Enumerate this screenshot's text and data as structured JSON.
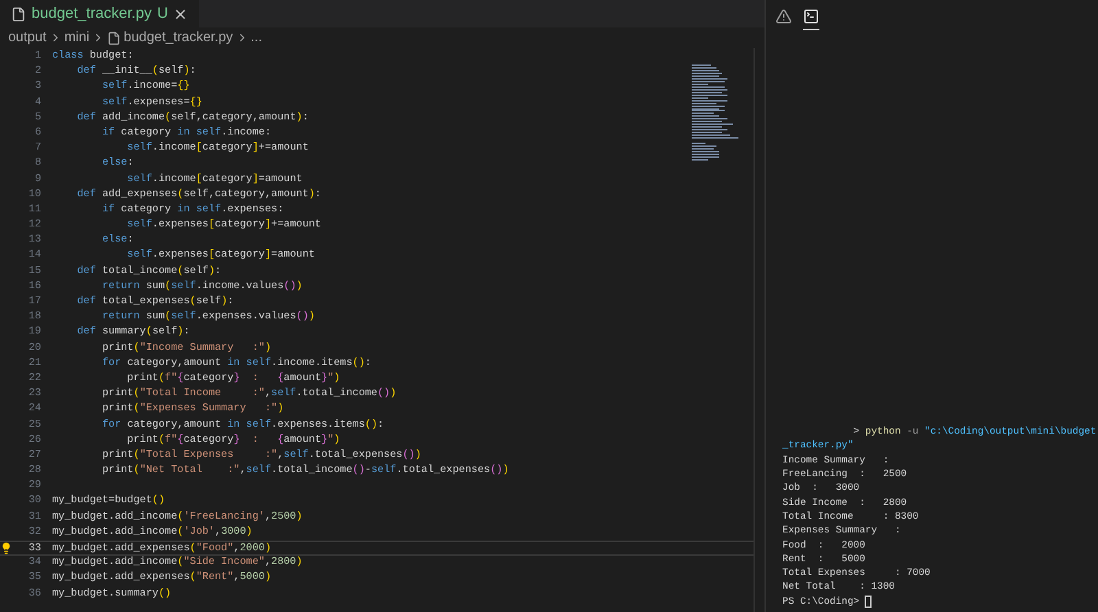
{
  "editor_tab": {
    "filename": "budget_tracker.py",
    "status": "U",
    "selected": true
  },
  "breadcrumbs": {
    "folders": [
      "output",
      "mini"
    ],
    "file": "budget_tracker.py",
    "more": "..."
  },
  "code_lines": [
    {
      "number": "1",
      "current": false,
      "tokens": [
        {
          "kind": "kw",
          "text": "class"
        },
        {
          "kind": "pl",
          "text": " budget:"
        }
      ]
    },
    {
      "number": "2",
      "current": false,
      "tokens": [
        {
          "kind": "kw",
          "text": "    def"
        },
        {
          "kind": "pl",
          "text": " __init__"
        },
        {
          "kind": "b1",
          "text": "("
        },
        {
          "kind": "pl",
          "text": "self"
        },
        {
          "kind": "b1",
          "text": ")"
        },
        {
          "kind": "pl",
          "text": ":"
        }
      ]
    },
    {
      "number": "3",
      "current": false,
      "tokens": [
        {
          "kind": "sf",
          "text": "        self"
        },
        {
          "kind": "pl",
          "text": ".income="
        },
        {
          "kind": "b1",
          "text": "{}"
        }
      ]
    },
    {
      "number": "4",
      "current": false,
      "tokens": [
        {
          "kind": "sf",
          "text": "        self"
        },
        {
          "kind": "pl",
          "text": ".expenses="
        },
        {
          "kind": "b1",
          "text": "{}"
        }
      ]
    },
    {
      "number": "5",
      "current": false,
      "tokens": [
        {
          "kind": "kw",
          "text": "    def"
        },
        {
          "kind": "pl",
          "text": " add_income"
        },
        {
          "kind": "b1",
          "text": "("
        },
        {
          "kind": "pl",
          "text": "self,category,amount"
        },
        {
          "kind": "b1",
          "text": ")"
        },
        {
          "kind": "pl",
          "text": ":"
        }
      ]
    },
    {
      "number": "6",
      "current": false,
      "tokens": [
        {
          "kind": "kw",
          "text": "        if"
        },
        {
          "kind": "pl",
          "text": " category "
        },
        {
          "kind": "kw",
          "text": "in"
        },
        {
          "kind": "sf",
          "text": " self"
        },
        {
          "kind": "pl",
          "text": ".income:"
        }
      ]
    },
    {
      "number": "7",
      "current": false,
      "tokens": [
        {
          "kind": "sf",
          "text": "            self"
        },
        {
          "kind": "pl",
          "text": ".income"
        },
        {
          "kind": "b1",
          "text": "["
        },
        {
          "kind": "pl",
          "text": "category"
        },
        {
          "kind": "b1",
          "text": "]"
        },
        {
          "kind": "pl",
          "text": "+=amount"
        }
      ]
    },
    {
      "number": "8",
      "current": false,
      "tokens": [
        {
          "kind": "kw",
          "text": "        else"
        },
        {
          "kind": "pl",
          "text": ":"
        }
      ]
    },
    {
      "number": "9",
      "current": false,
      "tokens": [
        {
          "kind": "sf",
          "text": "            self"
        },
        {
          "kind": "pl",
          "text": ".income"
        },
        {
          "kind": "b1",
          "text": "["
        },
        {
          "kind": "pl",
          "text": "category"
        },
        {
          "kind": "b1",
          "text": "]"
        },
        {
          "kind": "pl",
          "text": "=amount"
        }
      ]
    },
    {
      "number": "10",
      "current": false,
      "tokens": [
        {
          "kind": "kw",
          "text": "    def"
        },
        {
          "kind": "pl",
          "text": " add_expenses"
        },
        {
          "kind": "b1",
          "text": "("
        },
        {
          "kind": "pl",
          "text": "self,category,amount"
        },
        {
          "kind": "b1",
          "text": ")"
        },
        {
          "kind": "pl",
          "text": ":"
        }
      ]
    },
    {
      "number": "11",
      "current": false,
      "tokens": [
        {
          "kind": "kw",
          "text": "        if"
        },
        {
          "kind": "pl",
          "text": " category "
        },
        {
          "kind": "kw",
          "text": "in"
        },
        {
          "kind": "sf",
          "text": " self"
        },
        {
          "kind": "pl",
          "text": ".expenses:"
        }
      ]
    },
    {
      "number": "12",
      "current": false,
      "tokens": [
        {
          "kind": "sf",
          "text": "            self"
        },
        {
          "kind": "pl",
          "text": ".expenses"
        },
        {
          "kind": "b1",
          "text": "["
        },
        {
          "kind": "pl",
          "text": "category"
        },
        {
          "kind": "b1",
          "text": "]"
        },
        {
          "kind": "pl",
          "text": "+=amount"
        }
      ]
    },
    {
      "number": "13",
      "current": false,
      "tokens": [
        {
          "kind": "kw",
          "text": "        else"
        },
        {
          "kind": "pl",
          "text": ":"
        }
      ]
    },
    {
      "number": "14",
      "current": false,
      "tokens": [
        {
          "kind": "sf",
          "text": "            self"
        },
        {
          "kind": "pl",
          "text": ".expenses"
        },
        {
          "kind": "b1",
          "text": "["
        },
        {
          "kind": "pl",
          "text": "category"
        },
        {
          "kind": "b1",
          "text": "]"
        },
        {
          "kind": "pl",
          "text": "=amount"
        }
      ]
    },
    {
      "number": "15",
      "current": false,
      "tokens": [
        {
          "kind": "kw",
          "text": "    def"
        },
        {
          "kind": "pl",
          "text": " total_income"
        },
        {
          "kind": "b1",
          "text": "("
        },
        {
          "kind": "pl",
          "text": "self"
        },
        {
          "kind": "b1",
          "text": ")"
        },
        {
          "kind": "pl",
          "text": ":"
        }
      ]
    },
    {
      "number": "16",
      "current": false,
      "tokens": [
        {
          "kind": "kw",
          "text": "        return"
        },
        {
          "kind": "pl",
          "text": " sum"
        },
        {
          "kind": "b1",
          "text": "("
        },
        {
          "kind": "sf",
          "text": "self"
        },
        {
          "kind": "pl",
          "text": ".income.values"
        },
        {
          "kind": "b2",
          "text": "()"
        },
        {
          "kind": "b1",
          "text": ")"
        }
      ]
    },
    {
      "number": "17",
      "current": false,
      "tokens": [
        {
          "kind": "kw",
          "text": "    def"
        },
        {
          "kind": "pl",
          "text": " total_expenses"
        },
        {
          "kind": "b1",
          "text": "("
        },
        {
          "kind": "pl",
          "text": "self"
        },
        {
          "kind": "b1",
          "text": ")"
        },
        {
          "kind": "pl",
          "text": ":"
        }
      ]
    },
    {
      "number": "18",
      "current": false,
      "tokens": [
        {
          "kind": "kw",
          "text": "        return"
        },
        {
          "kind": "pl",
          "text": " sum"
        },
        {
          "kind": "b1",
          "text": "("
        },
        {
          "kind": "sf",
          "text": "self"
        },
        {
          "kind": "pl",
          "text": ".expenses.values"
        },
        {
          "kind": "b2",
          "text": "()"
        },
        {
          "kind": "b1",
          "text": ")"
        }
      ]
    },
    {
      "number": "19",
      "current": false,
      "tokens": [
        {
          "kind": "kw",
          "text": "    def"
        },
        {
          "kind": "pl",
          "text": " summary"
        },
        {
          "kind": "b1",
          "text": "("
        },
        {
          "kind": "pl",
          "text": "self"
        },
        {
          "kind": "b1",
          "text": ")"
        },
        {
          "kind": "pl",
          "text": ":"
        }
      ]
    },
    {
      "number": "20",
      "current": false,
      "tokens": [
        {
          "kind": "pl",
          "text": "        print"
        },
        {
          "kind": "b1",
          "text": "("
        },
        {
          "kind": "st",
          "text": "\"Income Summary   :\""
        },
        {
          "kind": "b1",
          "text": ")"
        }
      ]
    },
    {
      "number": "21",
      "current": false,
      "tokens": [
        {
          "kind": "kw",
          "text": "        for"
        },
        {
          "kind": "pl",
          "text": " category,amount "
        },
        {
          "kind": "kw",
          "text": "in"
        },
        {
          "kind": "sf",
          "text": " self"
        },
        {
          "kind": "pl",
          "text": ".income.items"
        },
        {
          "kind": "b1",
          "text": "()"
        },
        {
          "kind": "pl",
          "text": ":"
        }
      ]
    },
    {
      "number": "22",
      "current": false,
      "tokens": [
        {
          "kind": "pl",
          "text": "            print"
        },
        {
          "kind": "b1",
          "text": "("
        },
        {
          "kind": "st",
          "text": "f\""
        },
        {
          "kind": "b2",
          "text": "{"
        },
        {
          "kind": "pl",
          "text": "category"
        },
        {
          "kind": "b2",
          "text": "}"
        },
        {
          "kind": "st",
          "text": "  :   "
        },
        {
          "kind": "b2",
          "text": "{"
        },
        {
          "kind": "pl",
          "text": "amount"
        },
        {
          "kind": "b2",
          "text": "}"
        },
        {
          "kind": "st",
          "text": "\""
        },
        {
          "kind": "b1",
          "text": ")"
        }
      ]
    },
    {
      "number": "23",
      "current": false,
      "tokens": [
        {
          "kind": "pl",
          "text": "        print"
        },
        {
          "kind": "b1",
          "text": "("
        },
        {
          "kind": "st",
          "text": "\"Total Income     :\""
        },
        {
          "kind": "pl",
          "text": ","
        },
        {
          "kind": "sf",
          "text": "self"
        },
        {
          "kind": "pl",
          "text": ".total_income"
        },
        {
          "kind": "b2",
          "text": "()"
        },
        {
          "kind": "b1",
          "text": ")"
        }
      ]
    },
    {
      "number": "24",
      "current": false,
      "tokens": [
        {
          "kind": "pl",
          "text": "        print"
        },
        {
          "kind": "b1",
          "text": "("
        },
        {
          "kind": "st",
          "text": "\"Expenses Summary   :\""
        },
        {
          "kind": "b1",
          "text": ")"
        }
      ]
    },
    {
      "number": "25",
      "current": false,
      "tokens": [
        {
          "kind": "kw",
          "text": "        for"
        },
        {
          "kind": "pl",
          "text": " category,amount "
        },
        {
          "kind": "kw",
          "text": "in"
        },
        {
          "kind": "sf",
          "text": " self"
        },
        {
          "kind": "pl",
          "text": ".expenses.items"
        },
        {
          "kind": "b1",
          "text": "()"
        },
        {
          "kind": "pl",
          "text": ":"
        }
      ]
    },
    {
      "number": "26",
      "current": false,
      "tokens": [
        {
          "kind": "pl",
          "text": "            print"
        },
        {
          "kind": "b1",
          "text": "("
        },
        {
          "kind": "st",
          "text": "f\""
        },
        {
          "kind": "b2",
          "text": "{"
        },
        {
          "kind": "pl",
          "text": "category"
        },
        {
          "kind": "b2",
          "text": "}"
        },
        {
          "kind": "st",
          "text": "  :   "
        },
        {
          "kind": "b2",
          "text": "{"
        },
        {
          "kind": "pl",
          "text": "amount"
        },
        {
          "kind": "b2",
          "text": "}"
        },
        {
          "kind": "st",
          "text": "\""
        },
        {
          "kind": "b1",
          "text": ")"
        }
      ]
    },
    {
      "number": "27",
      "current": false,
      "tokens": [
        {
          "kind": "pl",
          "text": "        print"
        },
        {
          "kind": "b1",
          "text": "("
        },
        {
          "kind": "st",
          "text": "\"Total Expenses     :\""
        },
        {
          "kind": "pl",
          "text": ","
        },
        {
          "kind": "sf",
          "text": "self"
        },
        {
          "kind": "pl",
          "text": ".total_expenses"
        },
        {
          "kind": "b2",
          "text": "()"
        },
        {
          "kind": "b1",
          "text": ")"
        }
      ]
    },
    {
      "number": "28",
      "current": false,
      "tokens": [
        {
          "kind": "pl",
          "text": "        print"
        },
        {
          "kind": "b1",
          "text": "("
        },
        {
          "kind": "st",
          "text": "\"Net Total    :\""
        },
        {
          "kind": "pl",
          "text": ","
        },
        {
          "kind": "sf",
          "text": "self"
        },
        {
          "kind": "pl",
          "text": ".total_income"
        },
        {
          "kind": "b2",
          "text": "()"
        },
        {
          "kind": "pl",
          "text": "-"
        },
        {
          "kind": "sf",
          "text": "self"
        },
        {
          "kind": "pl",
          "text": ".total_expenses"
        },
        {
          "kind": "b2",
          "text": "()"
        },
        {
          "kind": "b1",
          "text": ")"
        }
      ]
    },
    {
      "number": "29",
      "current": false
    },
    {
      "number": "30",
      "current": false,
      "tokens": [
        {
          "kind": "pl",
          "text": "my_budget=budget"
        },
        {
          "kind": "b1",
          "text": "()"
        }
      ]
    },
    {
      "number": "31",
      "current": false,
      "tokens": [
        {
          "kind": "pl",
          "text": "my_budget.add_income"
        },
        {
          "kind": "b1",
          "text": "("
        },
        {
          "kind": "st",
          "text": "'FreeLancing'"
        },
        {
          "kind": "pl",
          "text": ","
        },
        {
          "kind": "nu",
          "text": "2500"
        },
        {
          "kind": "b1",
          "text": ")"
        }
      ]
    },
    {
      "number": "32",
      "current": false,
      "tokens": [
        {
          "kind": "pl",
          "text": "my_budget.add_income"
        },
        {
          "kind": "b1",
          "text": "("
        },
        {
          "kind": "st",
          "text": "'Job'"
        },
        {
          "kind": "pl",
          "text": ","
        },
        {
          "kind": "nu",
          "text": "3000"
        },
        {
          "kind": "b1",
          "text": ")"
        }
      ]
    },
    {
      "number": "33",
      "current": true,
      "tokens": [
        {
          "kind": "pl",
          "text": "my_budget.add_expenses"
        },
        {
          "kind": "b1",
          "text": "("
        },
        {
          "kind": "st",
          "text": "\"Food\""
        },
        {
          "kind": "pl",
          "text": ","
        },
        {
          "kind": "nu",
          "text": "2000"
        },
        {
          "kind": "b1",
          "text": ")"
        }
      ]
    },
    {
      "number": "34",
      "current": false,
      "tokens": [
        {
          "kind": "pl",
          "text": "my_budget.add_income"
        },
        {
          "kind": "b1",
          "text": "("
        },
        {
          "kind": "st",
          "text": "\"Side Income\""
        },
        {
          "kind": "pl",
          "text": ","
        },
        {
          "kind": "nu",
          "text": "2800"
        },
        {
          "kind": "b1",
          "text": ")"
        }
      ]
    },
    {
      "number": "35",
      "current": false,
      "tokens": [
        {
          "kind": "pl",
          "text": "my_budget.add_expenses"
        },
        {
          "kind": "b1",
          "text": "("
        },
        {
          "kind": "st",
          "text": "\"Rent\""
        },
        {
          "kind": "pl",
          "text": ","
        },
        {
          "kind": "nu",
          "text": "5000"
        },
        {
          "kind": "b1",
          "text": ")"
        }
      ]
    },
    {
      "number": "36",
      "current": false,
      "tokens": [
        {
          "kind": "pl",
          "text": "my_budget.summary"
        },
        {
          "kind": "b1",
          "text": "()"
        }
      ]
    }
  ],
  "panel_tabs": [
    {
      "kind": "problems",
      "selected": false
    },
    {
      "kind": "terminal",
      "selected": true
    }
  ],
  "terminal_lines": [
    {
      "tokens": [
        {
          "kind": "pl",
          "text": "            >"
        },
        {
          "kind": "cmd",
          "text": " python"
        },
        {
          "kind": "flag",
          "text": " -u"
        },
        {
          "kind": "path",
          "text": " \"c:\\Coding\\output\\mini\\budget"
        }
      ]
    },
    {
      "tokens": [
        {
          "kind": "path",
          "text": "_tracker.py\""
        }
      ]
    },
    {
      "tokens": [
        {
          "kind": "pl",
          "text": "Income Summary   :"
        }
      ]
    },
    {
      "tokens": [
        {
          "kind": "pl",
          "text": "FreeLancing  :   2500"
        }
      ]
    },
    {
      "tokens": [
        {
          "kind": "pl",
          "text": "Job  :   3000"
        }
      ]
    },
    {
      "tokens": [
        {
          "kind": "pl",
          "text": "Side Income  :   2800"
        }
      ]
    },
    {
      "tokens": [
        {
          "kind": "pl",
          "text": "Total Income     : 8300"
        }
      ]
    },
    {
      "tokens": [
        {
          "kind": "pl",
          "text": "Expenses Summary   :"
        }
      ]
    },
    {
      "tokens": [
        {
          "kind": "pl",
          "text": "Food  :   2000"
        }
      ]
    },
    {
      "tokens": [
        {
          "kind": "pl",
          "text": "Rent  :   5000"
        }
      ]
    },
    {
      "tokens": [
        {
          "kind": "pl",
          "text": "Total Expenses     : 7000"
        }
      ]
    },
    {
      "tokens": [
        {
          "kind": "pl",
          "text": "Net Total    : 1300"
        }
      ]
    },
    {
      "tokens": [
        {
          "kind": "pl",
          "text": "PS C:\\Coding>"
        }
      ],
      "cursor": true
    }
  ]
}
